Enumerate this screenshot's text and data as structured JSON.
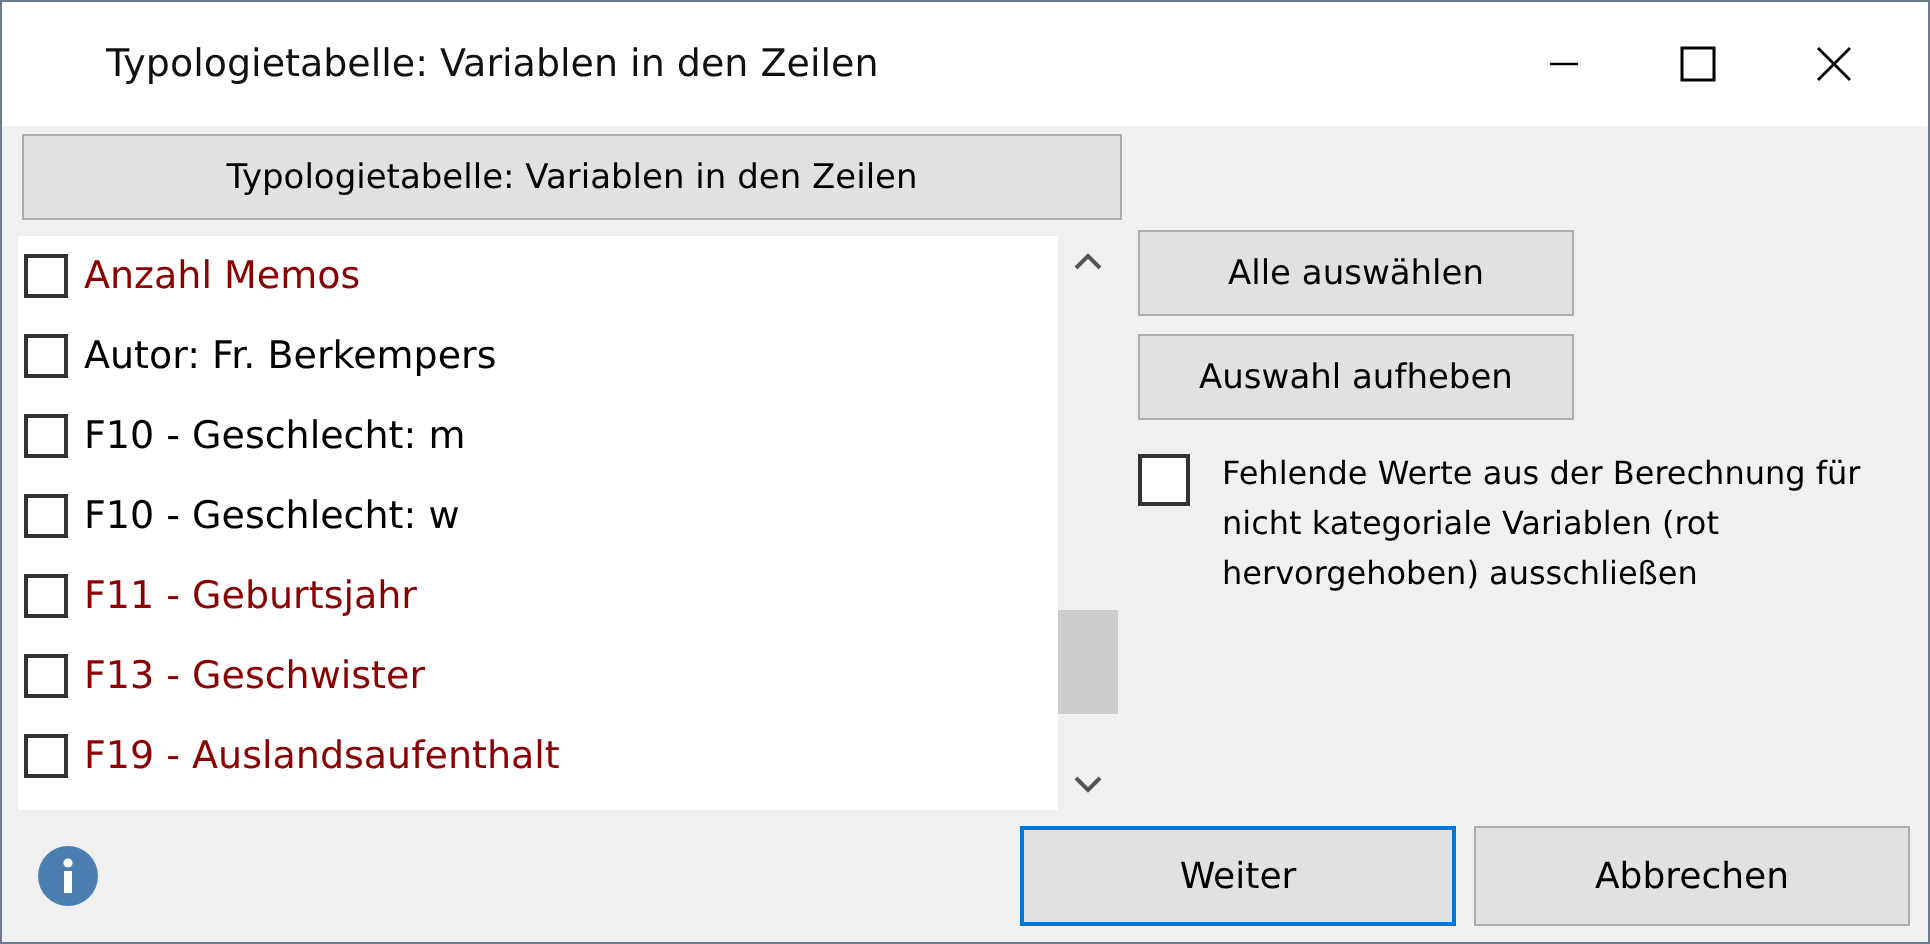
{
  "window": {
    "title": "Typologietabelle: Variablen in den Zeilen"
  },
  "header_button": "Typologietabelle: Variablen in den Zeilen",
  "variables": [
    {
      "label": "Anzahl Memos",
      "checked": false,
      "color": "#8b0000"
    },
    {
      "label": "Autor: Fr. Berkempers",
      "checked": false,
      "color": "#000000"
    },
    {
      "label": "F10 - Geschlecht: m",
      "checked": false,
      "color": "#000000"
    },
    {
      "label": "F10 - Geschlecht: w",
      "checked": false,
      "color": "#000000"
    },
    {
      "label": "F11 - Geburtsjahr",
      "checked": false,
      "color": "#8b0000"
    },
    {
      "label": "F13 - Geschwister",
      "checked": false,
      "color": "#8b0000"
    },
    {
      "label": "F19 - Auslandsaufenthalt",
      "checked": false,
      "color": "#8b0000"
    }
  ],
  "side_buttons": [
    "Alle auswählen",
    "Auswahl aufheben"
  ],
  "exclude_missing": {
    "label": "Fehlende Werte aus der Berechnung für nicht kategoriale Variablen (rot hervorgehoben) ausschließen",
    "checked": false
  },
  "buttons": [
    {
      "label": "Weiter",
      "focused": true
    },
    {
      "label": "Abbrechen",
      "focused": false
    }
  ]
}
